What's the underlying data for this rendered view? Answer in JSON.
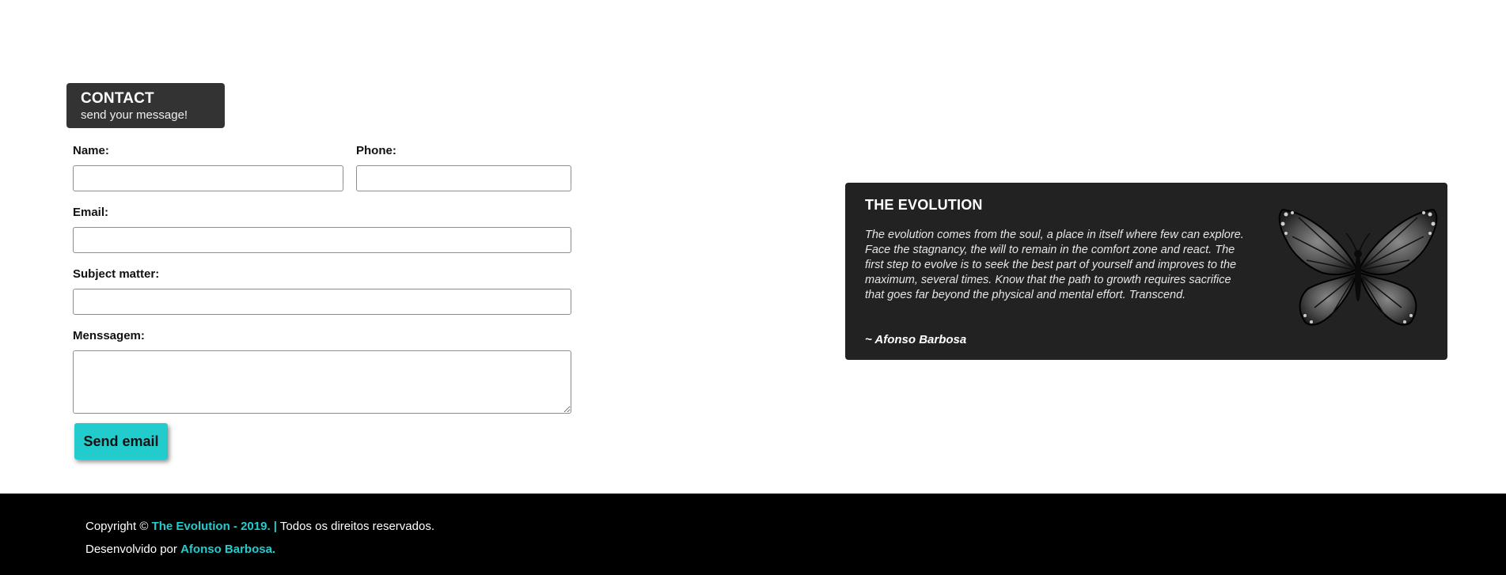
{
  "contact": {
    "title": "CONTACT",
    "subtitle": "send your message!"
  },
  "form": {
    "name_label": "Name:",
    "name_value": "",
    "phone_label": "Phone:",
    "phone_value": "",
    "email_label": "Email:",
    "email_value": "",
    "subject_label": "Subject matter:",
    "subject_value": "",
    "message_label": "Menssagem:",
    "message_value": "",
    "send_label": "Send email"
  },
  "evolution": {
    "title": "THE EVOLUTION",
    "text": "The evolution comes from the soul, a place in itself where few can explore. Face the stagnancy, the will to remain in the comfort zone and react. The first step to evolve is to seek the best part of yourself and improves to the maximum, several times. Know that the path to growth requires sacrifice that goes far beyond the physical and mental effort. Transcend.",
    "author": "~ Afonso Barbosa",
    "image_icon": "butterfly-icon"
  },
  "footer": {
    "copyright_prefix": "Copyright ©",
    "site_name": "The Evolution - 2019. |",
    "rights": "Todos os direitos reservados.",
    "developed_by": "Desenvolvido por",
    "developer": "Afonso Barbosa."
  },
  "colors": {
    "accent": "#22cccc",
    "card_bg": "#222222",
    "badge_bg": "#333333",
    "footer_bg": "#000000"
  }
}
